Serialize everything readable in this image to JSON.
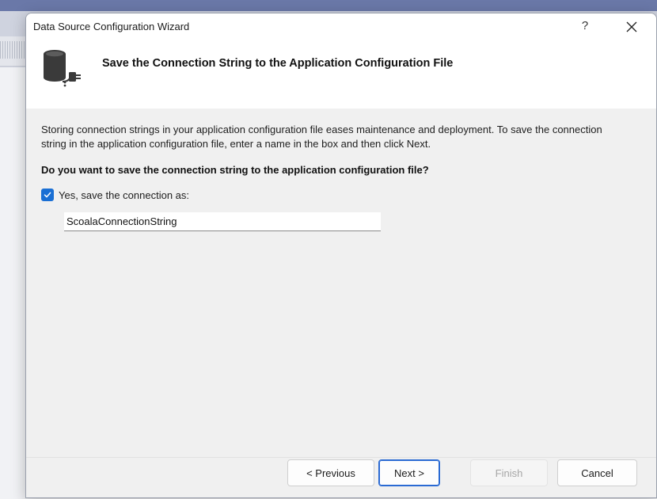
{
  "window": {
    "title": "Data Source Configuration Wizard",
    "help_label": "?",
    "close_label": "Close"
  },
  "header": {
    "title": "Save the Connection String to the Application Configuration File"
  },
  "content": {
    "description": "Storing connection strings in your application configuration file eases maintenance and deployment. To save the connection string in the application configuration file, enter a name in the box and then click Next.",
    "question": "Do you want to save the connection string to the application configuration file?",
    "save_checkbox": {
      "label": "Yes, save the connection as:",
      "checked": true
    },
    "connection_name": {
      "value": "ScoalaConnectionString"
    }
  },
  "footer": {
    "previous_label": "< Previous",
    "next_label": "Next >",
    "finish_label": "Finish",
    "cancel_label": "Cancel"
  },
  "colors": {
    "accent": "#1a6fd4",
    "default_button_border": "#2a6ad3",
    "dialog_background": "#f0f0f0",
    "header_background": "#ffffff"
  }
}
